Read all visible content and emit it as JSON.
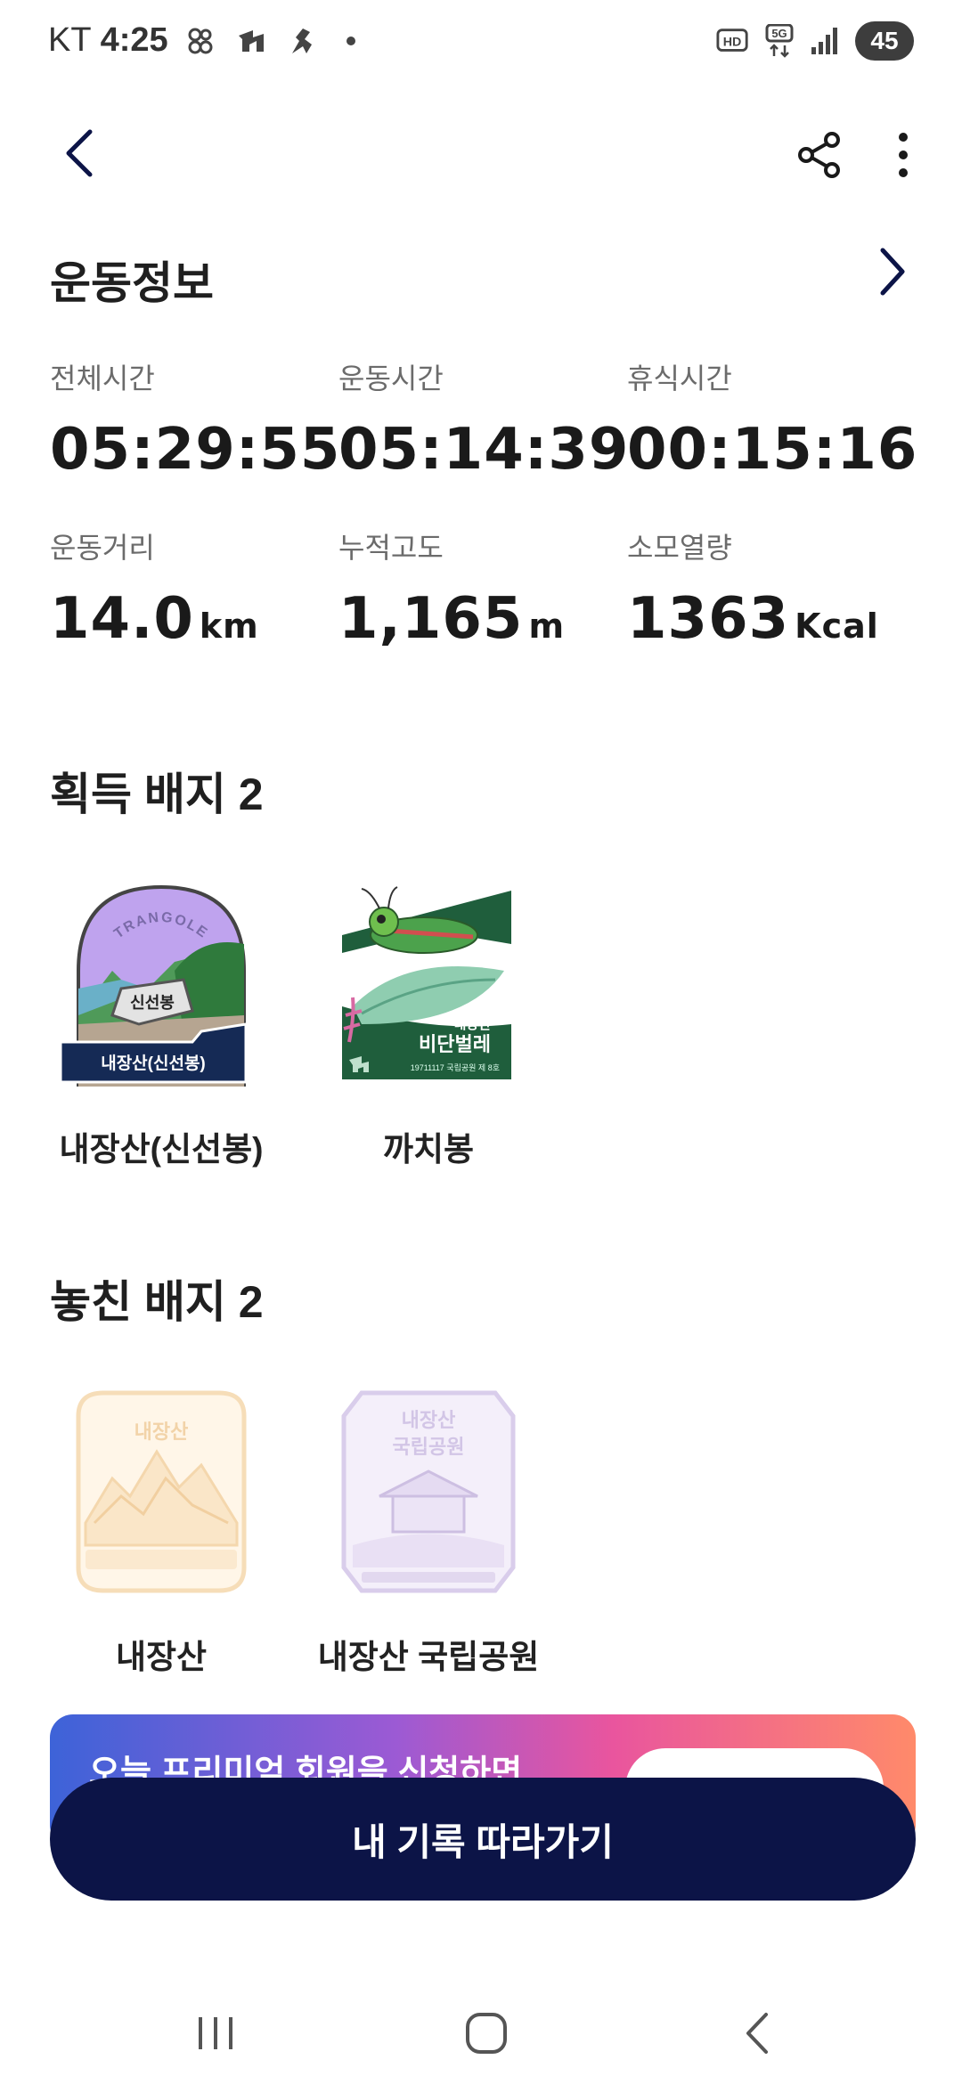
{
  "status_bar": {
    "carrier": "KT",
    "time": "4:25",
    "battery": "45",
    "icons": [
      "dual-sim-icon",
      "trangle-app-icon",
      "runner-app-icon",
      "notification-dot-icon",
      "hd-voice-icon",
      "5g-icon",
      "signal-icon",
      "battery-icon"
    ]
  },
  "toolbar": {
    "back": "back-icon",
    "share": "share-icon",
    "more": "more-vertical-icon"
  },
  "exercise_info": {
    "title": "운동정보",
    "stats": [
      {
        "label": "전체시간",
        "value": "05:29:55",
        "unit": ""
      },
      {
        "label": "운동시간",
        "value": "05:14:39",
        "unit": ""
      },
      {
        "label": "휴식시간",
        "value": "00:15:16",
        "unit": ""
      },
      {
        "label": "운동거리",
        "value": "14.0",
        "unit": "km"
      },
      {
        "label": "누적고도",
        "value": "1,165",
        "unit": "m"
      },
      {
        "label": "소모열량",
        "value": "1363",
        "unit": "Kcal"
      }
    ]
  },
  "earned_badges": {
    "title": "획득 배지 2",
    "items": [
      {
        "name": "내장산(신선봉)",
        "badge_text": "내장산(신선봉)",
        "sign_text": "신선봉",
        "arc_text": "TRANGOLE"
      },
      {
        "name": "까치봉",
        "badge_text_1": "내장산",
        "badge_text_2": "비단벌레",
        "badge_text_3": "19711117 국립공원 제 8호"
      }
    ]
  },
  "missed_badges": {
    "title": "놓친 배지 2",
    "items": [
      {
        "name": "내장산",
        "badge_text": "내장산"
      },
      {
        "name": "내장산 국립공원",
        "badge_text_1": "내장산",
        "badge_text_2": "국립공원"
      }
    ]
  },
  "premium_banner": {
    "text": "오늘 프리미엄 회원을 신청하면"
  },
  "follow_button": {
    "label": "내 기록 따라가기"
  },
  "nav_bar": {
    "recents": "recents-icon",
    "home": "home-icon",
    "back": "nav-back-icon"
  },
  "colors": {
    "accent": "#0c1447",
    "text": "#1a1a1a",
    "label": "#6b6b6b"
  }
}
